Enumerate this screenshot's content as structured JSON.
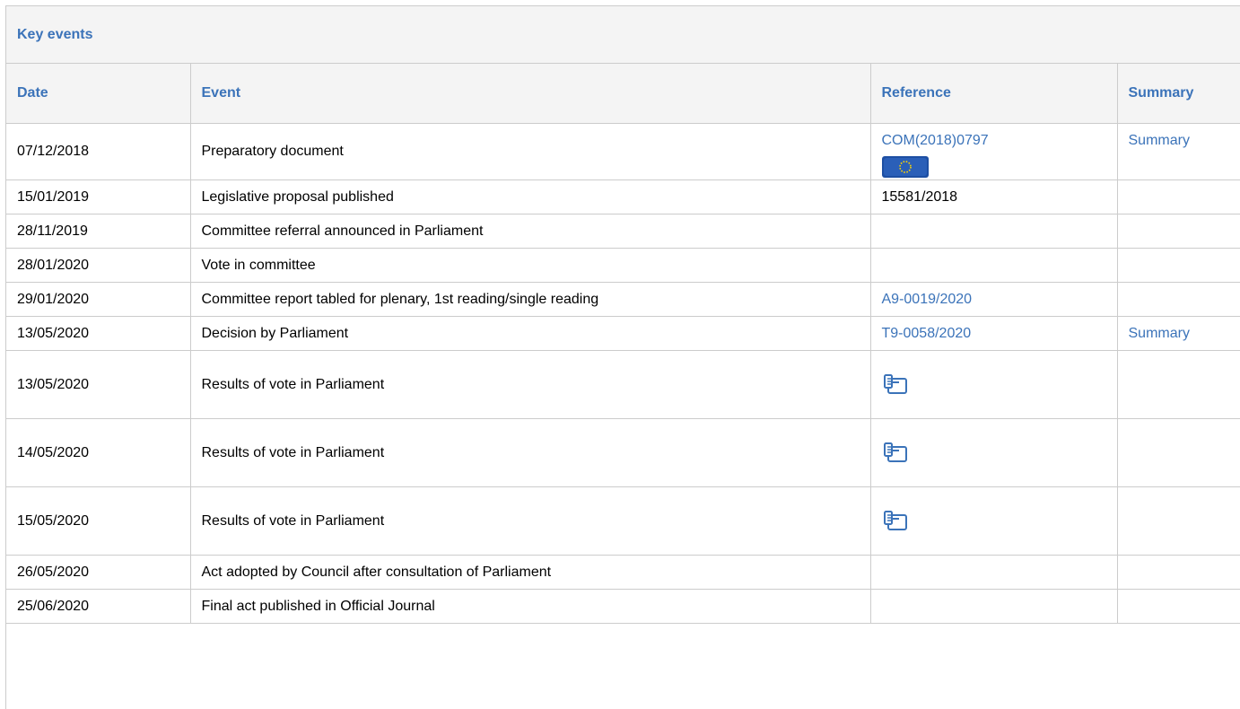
{
  "panel": {
    "title": "Key events"
  },
  "headers": {
    "date": "Date",
    "event": "Event",
    "reference": "Reference",
    "summary": "Summary"
  },
  "rows": [
    {
      "date": "07/12/2018",
      "event": "Preparatory document",
      "reference": "COM(2018)0797",
      "summary": "Summary"
    },
    {
      "date": "15/01/2019",
      "event": "Legislative proposal published",
      "reference": "15581/2018",
      "summary": ""
    },
    {
      "date": "28/11/2019",
      "event": "Committee referral announced in Parliament",
      "reference": "",
      "summary": ""
    },
    {
      "date": "28/01/2020",
      "event": "Vote in committee",
      "reference": "",
      "summary": ""
    },
    {
      "date": "29/01/2020",
      "event": "Committee report tabled for plenary, 1st reading/single reading",
      "reference": "A9-0019/2020",
      "summary": ""
    },
    {
      "date": "13/05/2020",
      "event": "Decision by Parliament",
      "reference": "T9-0058/2020",
      "summary": "Summary"
    },
    {
      "date": "13/05/2020",
      "event": "Results of vote in Parliament",
      "reference": "",
      "summary": ""
    },
    {
      "date": "14/05/2020",
      "event": "Results of vote in Parliament",
      "reference": "",
      "summary": ""
    },
    {
      "date": "15/05/2020",
      "event": "Results of vote in Parliament",
      "reference": "",
      "summary": ""
    },
    {
      "date": "26/05/2020",
      "event": "Act adopted by Council after consultation of Parliament",
      "reference": "",
      "summary": ""
    },
    {
      "date": "25/06/2020",
      "event": "Final act published in Official Journal",
      "reference": "",
      "summary": ""
    }
  ],
  "icons": {
    "eu_flag": "eu-flag-icon",
    "vote_results": "vote-results-icon"
  },
  "colors": {
    "link": "#3b73b9",
    "header_bg": "#f4f4f4",
    "border": "#cccccc",
    "flag_blue": "#1d4fa3",
    "flag_star": "#ffd400"
  }
}
